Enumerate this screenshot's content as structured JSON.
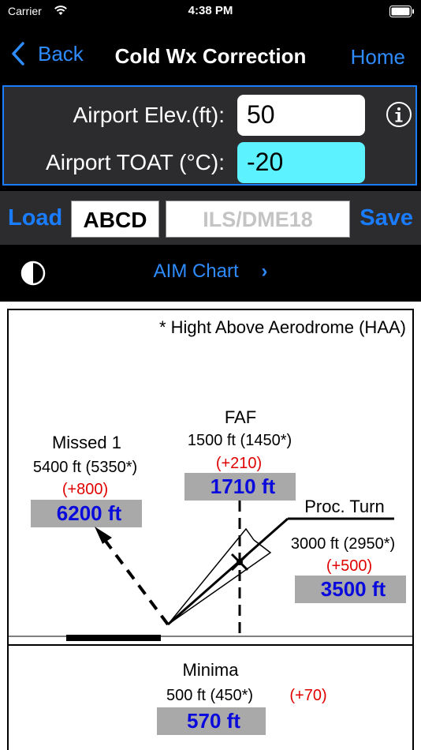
{
  "status": {
    "carrier": "Carrier",
    "time": "4:38 PM"
  },
  "nav": {
    "back": "Back",
    "title": "Cold Wx Correction",
    "home": "Home"
  },
  "inputs": {
    "elev_label": "Airport Elev.(ft):",
    "elev_value": "50",
    "toat_label": "Airport TOAT (°C):",
    "toat_value": "-20"
  },
  "toolbar": {
    "load": "Load",
    "airport_code": "ABCD",
    "procedure": "ILS/DME18",
    "save": "Save"
  },
  "aim": {
    "label": "AIM Chart",
    "chevron": "›"
  },
  "chart": {
    "haa_note": "* Hight Above Aerodrome (HAA)",
    "missed": {
      "title": "Missed 1",
      "alt": "5400 ft (5350*)",
      "corr": "(+800)",
      "result": "6200 ft"
    },
    "faf": {
      "title": "FAF",
      "alt": "1500 ft (1450*)",
      "corr": "(+210)",
      "result": "1710 ft"
    },
    "proc_turn": {
      "title": "Proc. Turn",
      "alt": "3000 ft (2950*)",
      "corr": "(+500)",
      "result": "3500 ft"
    },
    "minima": {
      "title": "Minima",
      "alt": "500 ft (450*)",
      "corr": "(+70)",
      "result": "570 ft"
    }
  },
  "colors": {
    "accent": "#2f8cff",
    "cyan_field": "#5cf2ff",
    "correction_red": "#e00000",
    "result_blue": "#0a0adc",
    "result_box": "#a9a9a9"
  },
  "icons": [
    "wifi-icon",
    "battery-icon",
    "chevron-left-icon",
    "info-icon",
    "contrast-icon",
    "chevron-right-icon"
  ]
}
